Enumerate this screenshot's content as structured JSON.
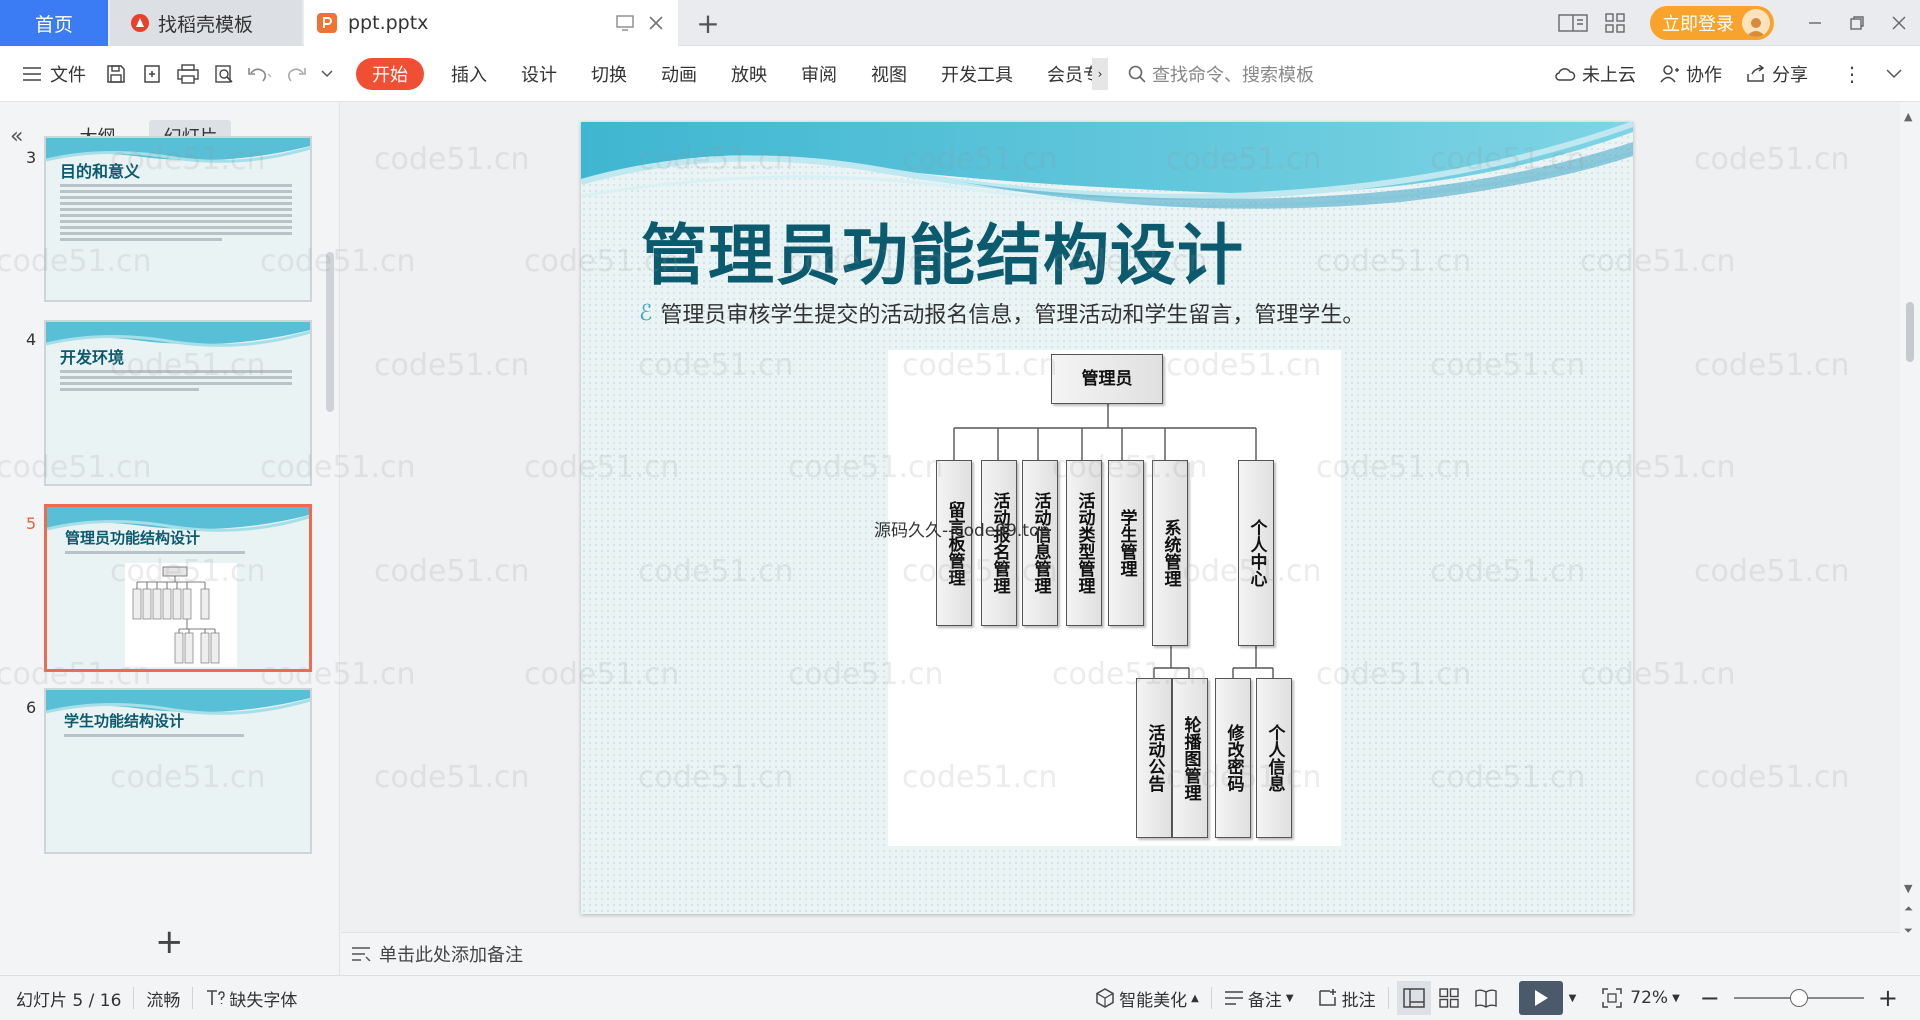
{
  "tabs": {
    "home": "首页",
    "template": "找稻壳模板",
    "file": "ppt.pptx"
  },
  "account": {
    "login": "立即登录"
  },
  "ribbon": {
    "file_menu": "文件",
    "menus": [
      "开始",
      "插入",
      "设计",
      "切换",
      "动画",
      "放映",
      "审阅",
      "视图",
      "开发工具",
      "会员专享"
    ],
    "search_placeholder": "查找命令、搜索模板",
    "cloud": "未上云",
    "collab": "协作",
    "share": "分享"
  },
  "left_panel": {
    "tabs": [
      "大纲",
      "幻灯片"
    ],
    "thumbnails": [
      {
        "num": "3",
        "title": "目的和意义"
      },
      {
        "num": "4",
        "title": "开发环境"
      },
      {
        "num": "5",
        "title": "管理员功能结构设计"
      },
      {
        "num": "6",
        "title": "学生功能结构设计"
      }
    ]
  },
  "slide": {
    "title": "管理员功能结构设计",
    "bullet": "管理员审核学生提交的活动报名信息，管理活动和学生留言，管理学生。",
    "overlay": "源码久久--code99.top",
    "org": {
      "root": "管理员",
      "children": [
        "留言板管理",
        "活动报名管理",
        "活动信息管理",
        "活动类型管理",
        "学生管理",
        "系统管理",
        "个人中心"
      ],
      "system_children": [
        "活动公告",
        "轮播图管理"
      ],
      "personal_children": [
        "修改密码",
        "个人信息"
      ]
    }
  },
  "notes": {
    "placeholder": "单击此处添加备注"
  },
  "status": {
    "slide_counter": "幻灯片 5 / 16",
    "theme": "流畅",
    "missing_font": "缺失字体",
    "beautify": "智能美化",
    "notes": "备注",
    "comments": "批注",
    "zoom": "72%",
    "zoom_fraction": 0.72
  },
  "watermark": "code51.cn",
  "colors": {
    "accent": "#f04f33",
    "home_tab": "#3b7cf4",
    "login": "#f7a32c",
    "title": "#0c5a6e"
  }
}
